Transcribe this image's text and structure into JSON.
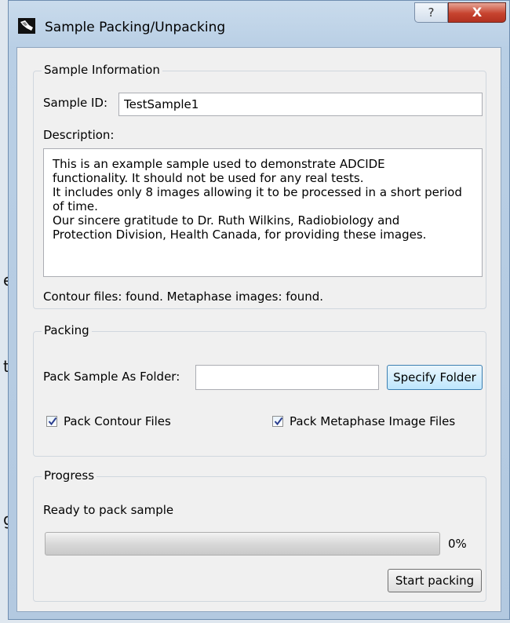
{
  "window": {
    "title": "Sample Packing/Unpacking",
    "help_label": "?",
    "close_label": "X"
  },
  "desktop_fragments": [
    "e",
    "t",
    "g"
  ],
  "sample_info": {
    "group_title": "Sample Information",
    "sample_id_label": "Sample ID:",
    "sample_id_value": "TestSample1",
    "description_label": "Description:",
    "description_lines": [
      "This is an example sample used to demonstrate ADCIDE",
      "functionality. It should not be used for any real tests.",
      "It includes only 8 images allowing it to be processed in a short period",
      "of time.",
      "Our sincere gratitude to Dr. Ruth Wilkins, Radiobiology and",
      "Protection Division, Health Canada, for providing these images."
    ],
    "status_text": "Contour files: found. Metaphase images: found."
  },
  "packing": {
    "group_title": "Packing",
    "folder_label": "Pack Sample As Folder:",
    "folder_value": "",
    "specify_button": "Specify Folder",
    "pack_contour_label": "Pack Contour Files",
    "pack_contour_checked": true,
    "pack_metaphase_label": "Pack Metaphase Image Files",
    "pack_metaphase_checked": true
  },
  "progress": {
    "group_title": "Progress",
    "status_text": "Ready to pack sample",
    "value": 0,
    "percent_text": "0%",
    "start_button": "Start packing"
  }
}
